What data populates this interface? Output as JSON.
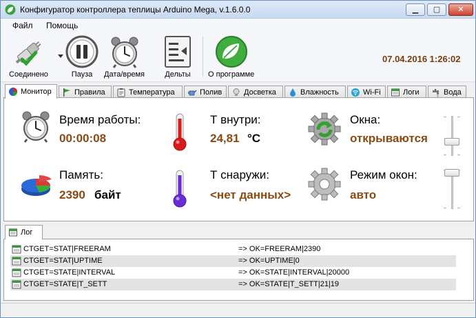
{
  "window": {
    "title": "Конфигуратор контроллера теплицы Arduino Mega, v.1.6.0.0",
    "buttons": {
      "minimize": "▁",
      "maximize": "▢",
      "close": "✕"
    }
  },
  "menu": {
    "file": "Файл",
    "help": "Помощь"
  },
  "toolbar": {
    "connected_label": "Соединено",
    "pause_label": "Пауза",
    "datetime_label": "Дата/время",
    "deltas_label": "Дельты",
    "about_label": "О программе",
    "current_datetime": "07.04.2016 1:26:02"
  },
  "tabs": [
    {
      "label": "Монитор",
      "icon": "pie-chart-icon",
      "active": true
    },
    {
      "label": "Правила",
      "icon": "flag-icon",
      "active": false
    },
    {
      "label": "Температура",
      "icon": "clipboard-icon",
      "active": false
    },
    {
      "label": "Полив",
      "icon": "watering-can-icon",
      "active": false
    },
    {
      "label": "Досветка",
      "icon": "lightbulb-icon",
      "active": false
    },
    {
      "label": "Влажность",
      "icon": "water-drop-icon",
      "active": false
    },
    {
      "label": "Wi-Fi",
      "icon": "wifi-icon",
      "active": false
    },
    {
      "label": "Логи",
      "icon": "calendar-icon",
      "active": false
    },
    {
      "label": "Вода",
      "icon": "faucet-icon",
      "active": false
    }
  ],
  "monitor": {
    "uptime_label": "Время работы:",
    "uptime_value": "00:00:08",
    "memory_label": "Память:",
    "memory_value": "2390",
    "memory_unit": "байт",
    "temp_inside_label": "Т внутри:",
    "temp_inside_value": "24,81",
    "temp_inside_unit": "°C",
    "temp_outside_label": "Т снаружи:",
    "temp_outside_value": "<нет данных>",
    "windows_label": "Окна:",
    "windows_value": "открываются",
    "window_mode_label": "Режим окон:",
    "window_mode_value": "авто",
    "colors": {
      "value": "#8a4a12",
      "thermo_hot": "#d81b1b",
      "thermo_cold": "#6a2bd8"
    }
  },
  "log": {
    "tab_label": "Лог",
    "entries": [
      {
        "command": "CTGET=STAT|FREERAM",
        "response": "=> OK=FREERAM|2390"
      },
      {
        "command": "CTGET=STAT|UPTIME",
        "response": "=> OK=UPTIME|0"
      },
      {
        "command": "CTGET=STATE|INTERVAL",
        "response": "=> OK=STATE|INTERVAL|20000"
      },
      {
        "command": "CTGET=STATE|T_SETT",
        "response": "=> OK=STATE|T_SETT|21|19"
      }
    ]
  }
}
